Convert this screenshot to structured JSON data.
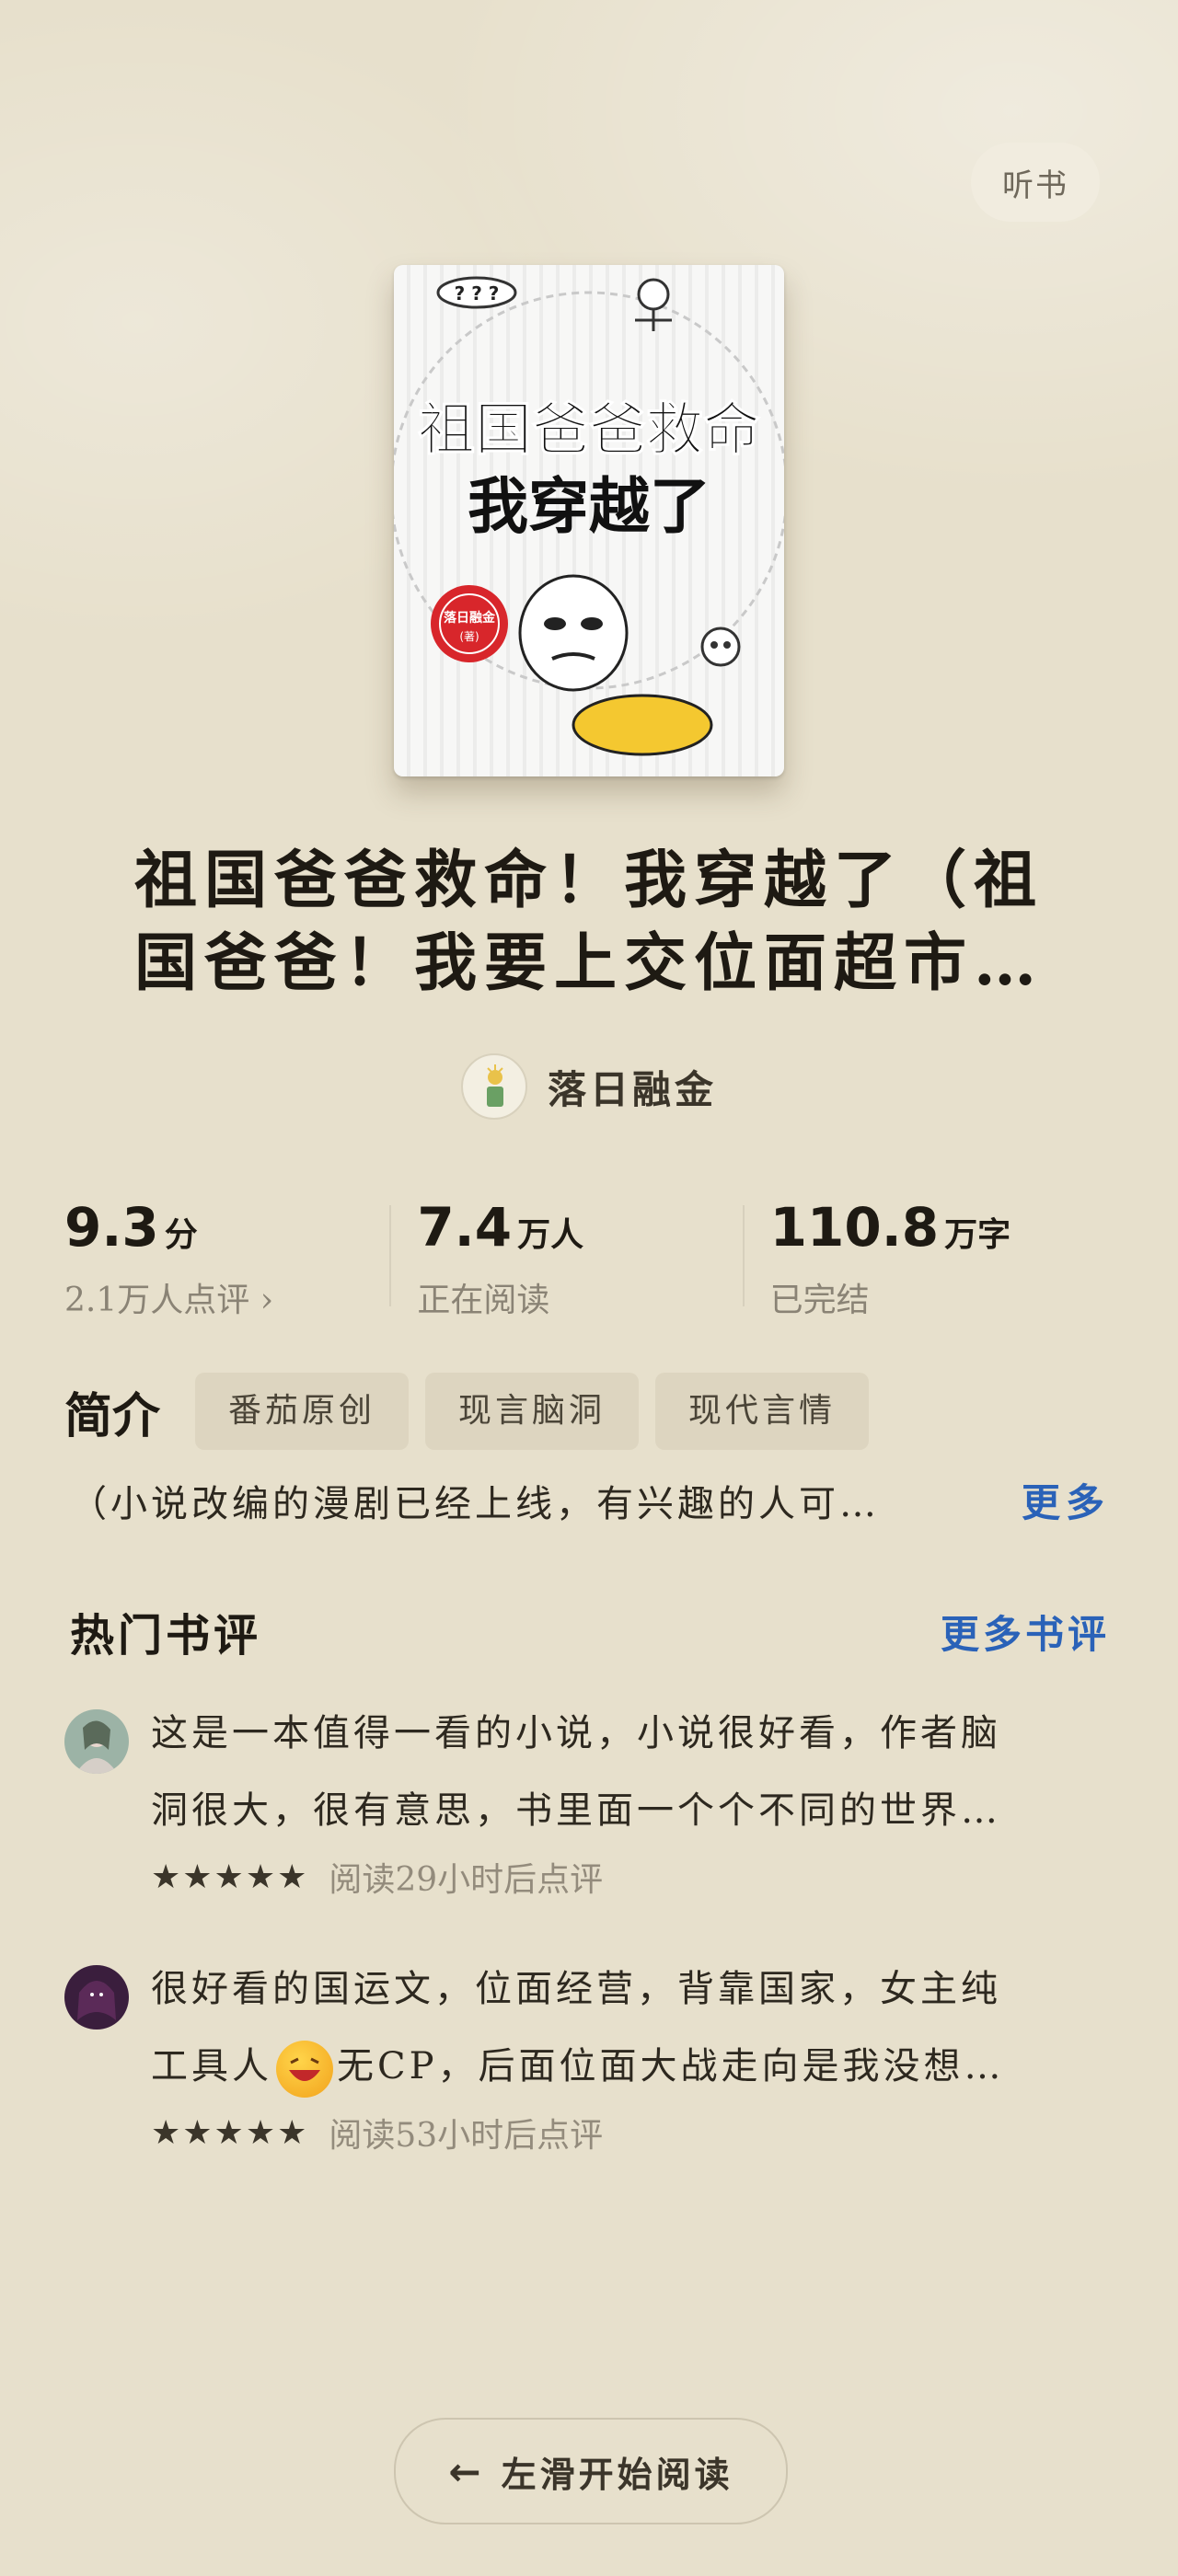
{
  "header": {
    "listen_label": "听书"
  },
  "book": {
    "cover_title_line1": "祖国爸爸救命",
    "cover_title_line2": "我穿越了",
    "cover_badge": "落日融金",
    "cover_badge_sub": "(著)",
    "cover_thought": "? ? ?",
    "title_line1": "祖国爸爸救命！我穿越了（祖",
    "title_line2": "国爸爸！我要上交位面超市…",
    "author": "落日融金"
  },
  "stats": [
    {
      "value": "9.3",
      "unit": "分",
      "sub": "2.1万人点评 ›"
    },
    {
      "value": "7.4",
      "unit": "万人",
      "sub": "正在阅读"
    },
    {
      "value": "110.8",
      "unit": "万字",
      "sub": "已完结"
    }
  ],
  "intro": {
    "label": "简介",
    "tags": [
      "番茄原创",
      "现言脑洞",
      "现代言情"
    ],
    "text": "（小说改编的漫剧已经上线，有兴趣的人可…",
    "more": "更多"
  },
  "reviews": {
    "title": "热门书评",
    "more": "更多书评",
    "items": [
      {
        "line1": "这是一本值得一看的小说，小说很好看，作者脑",
        "line2": "洞很大，很有意思，书里面一个个不同的世界…",
        "stars": "★★★★★",
        "meta": "阅读29小时后点评"
      },
      {
        "line1": "很好看的国运文，位面经营，背靠国家，女主纯",
        "line2_a": "工具人",
        "line2_b": "无CP，后面位面大战走向是我没想…",
        "stars": "★★★★★",
        "meta": "阅读53小时后点评"
      }
    ]
  },
  "footer": {
    "start_label": "左滑开始阅读",
    "arrow_icon": "arrow-left-icon"
  },
  "colors": {
    "background": "#e7e0cc",
    "link": "#2a62b8"
  }
}
